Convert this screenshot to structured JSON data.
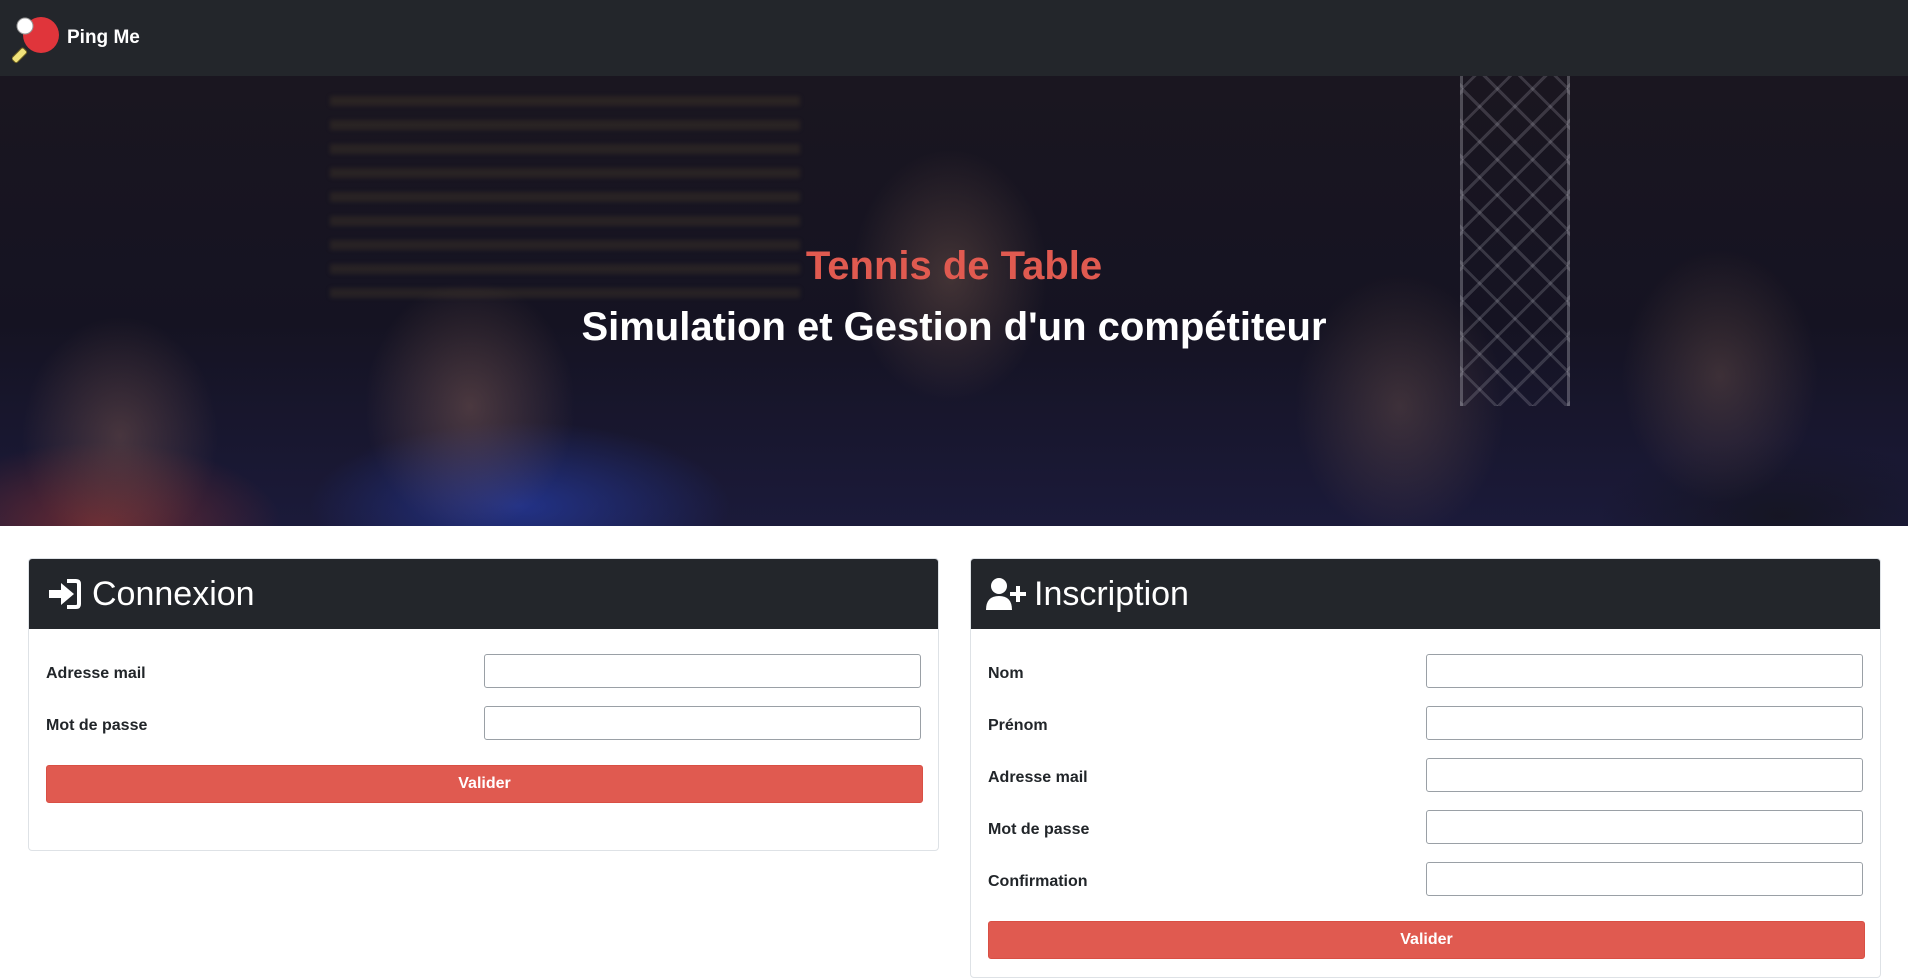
{
  "navbar": {
    "brand": "Ping Me",
    "logo_icon": "ping-pong-paddle-icon",
    "colors": {
      "background": "#23262b",
      "paddle": "#e0353b",
      "handle": "#f0e27a"
    }
  },
  "hero": {
    "title": "Tennis de Table",
    "subtitle": "Simulation et Gestion d'un compétiteur",
    "colors": {
      "title": "#e05a50",
      "subtitle": "#ffffff"
    }
  },
  "login": {
    "icon": "sign-in-icon",
    "title": "Connexion",
    "fields": [
      {
        "label": "Adresse mail",
        "value": ""
      },
      {
        "label": "Mot de passe",
        "value": ""
      }
    ],
    "submit_label": "Valider"
  },
  "register": {
    "icon": "user-plus-icon",
    "title": "Inscription",
    "fields": [
      {
        "label": "Nom",
        "value": ""
      },
      {
        "label": "Prénom",
        "value": ""
      },
      {
        "label": "Adresse mail",
        "value": ""
      },
      {
        "label": "Mot de passe",
        "value": ""
      },
      {
        "label": "Confirmation",
        "value": ""
      }
    ],
    "submit_label": "Valider"
  },
  "colors": {
    "accent": "#e05a50",
    "header": "#23262b"
  }
}
